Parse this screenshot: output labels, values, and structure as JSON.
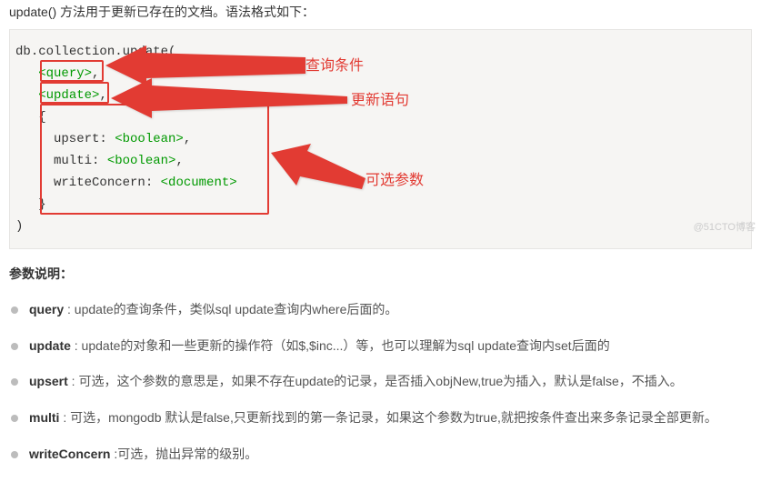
{
  "intro": "update() 方法用于更新已存在的文档。语法格式如下：",
  "code": {
    "l1a": "db",
    "l1b": ".collection",
    "l1c": ".update(",
    "l2a": "   ",
    "l2b": "<query>",
    "l2c": ",",
    "l3a": "   ",
    "l3b": "<update>",
    "l3c": ",",
    "l4a": "   {",
    "l5a": "     upsert: ",
    "l5b": "<boolean>",
    "l5c": ",",
    "l6a": "     multi: ",
    "l6b": "<boolean>",
    "l6c": ",",
    "l7a": "     writeConcern: ",
    "l7b": "<document>",
    "l8a": "   }",
    "l9a": ")"
  },
  "annotations": {
    "query_label": "查询条件",
    "update_label": "更新语句",
    "options_label": "可选参数"
  },
  "params_heading": "参数说明：",
  "params": [
    {
      "name": "query",
      "desc": " : update的查询条件，类似sql update查询内where后面的。"
    },
    {
      "name": "update",
      "desc": " : update的对象和一些更新的操作符（如$,$inc...）等，也可以理解为sql update查询内set后面的"
    },
    {
      "name": "upsert",
      "desc": " : 可选，这个参数的意思是，如果不存在update的记录，是否插入objNew,true为插入，默认是false，不插入。"
    },
    {
      "name": "multi",
      "desc": " : 可选，mongodb 默认是false,只更新找到的第一条记录，如果这个参数为true,就把按条件查出来多条记录全部更新。"
    },
    {
      "name": "writeConcern",
      "desc": " :可选，抛出异常的级别。"
    }
  ],
  "watermark": "@51CTO博客"
}
